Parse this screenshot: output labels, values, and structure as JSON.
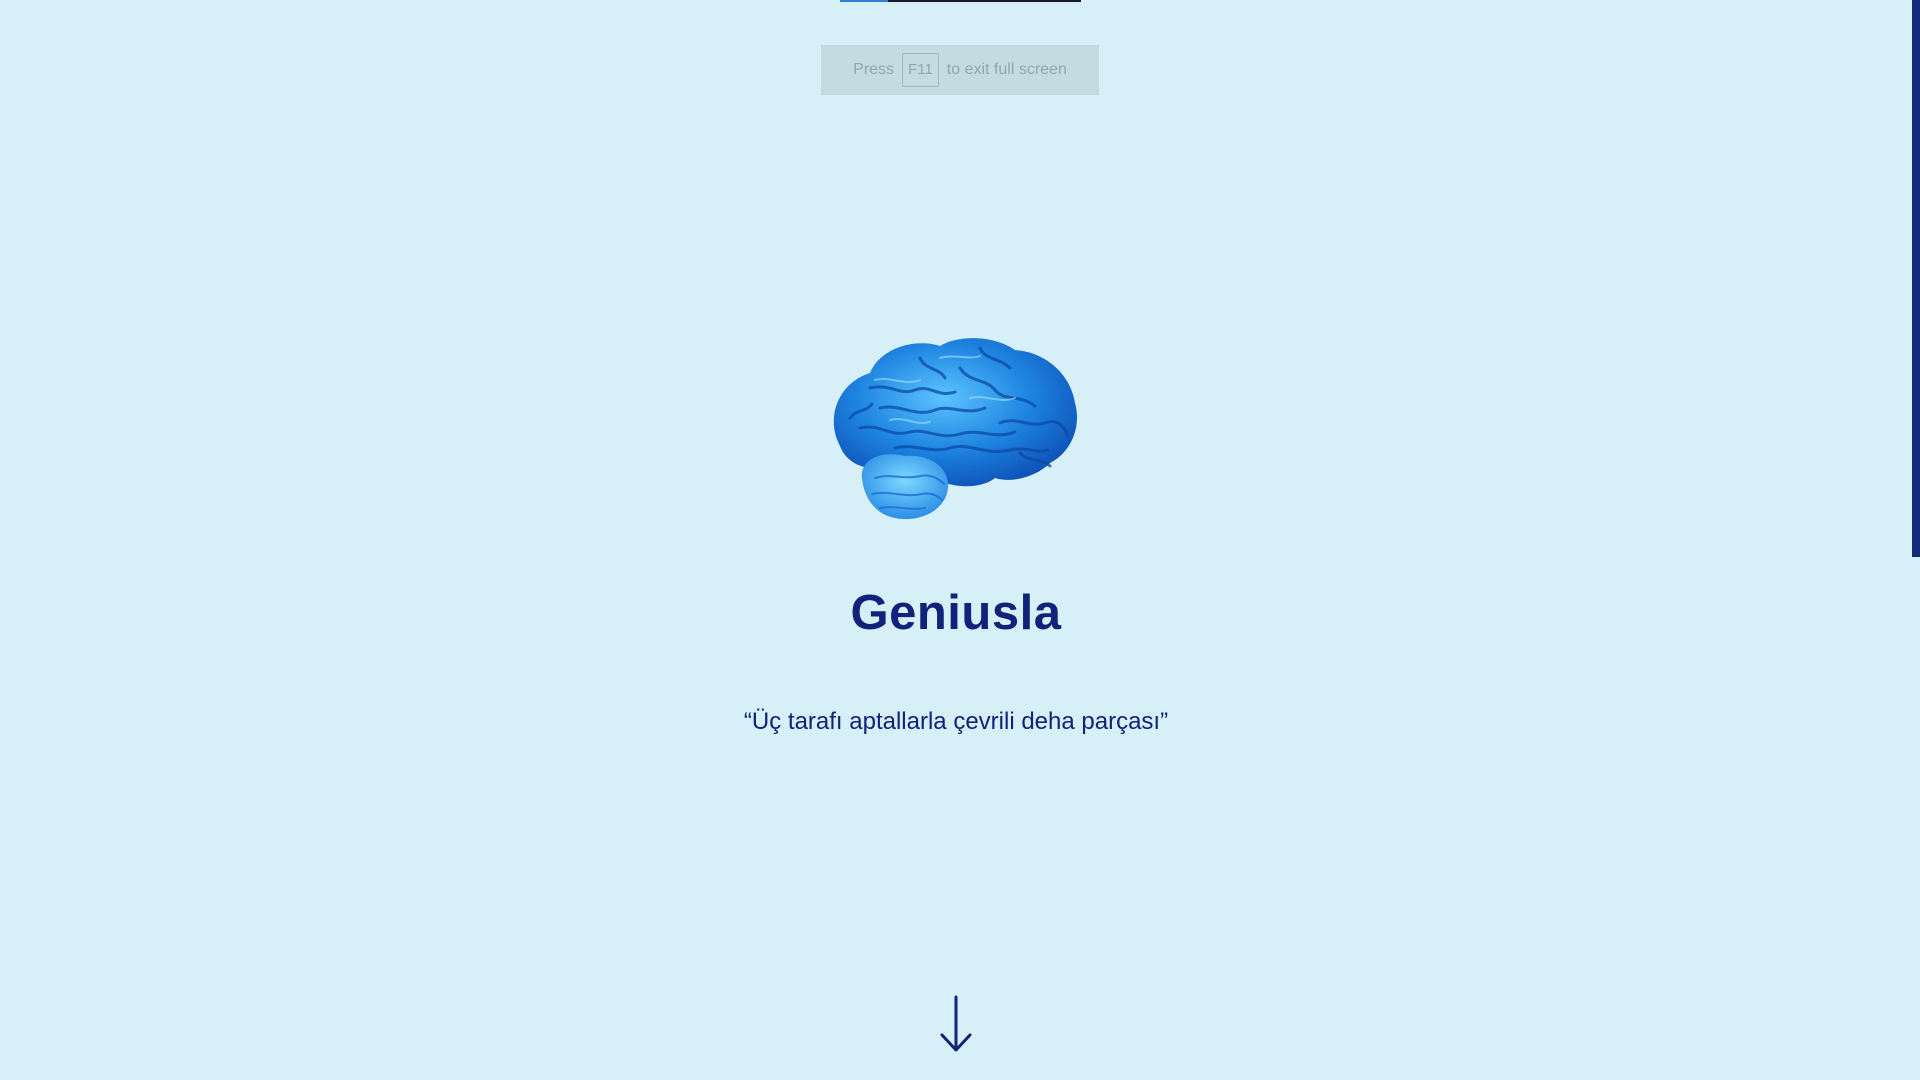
{
  "fullscreen_hint": {
    "press": "Press",
    "key": "F11",
    "suffix": "to exit full screen"
  },
  "hero": {
    "brain_icon": "brain-icon",
    "title": "Geniusla",
    "quote": "“Üç tarafı aptallarla çevrili deha parçası”",
    "scroll_icon": "arrow-down-icon"
  },
  "colors": {
    "background": "#d7eff6",
    "accent": "#11227a",
    "brain": "#1e8ae6"
  }
}
